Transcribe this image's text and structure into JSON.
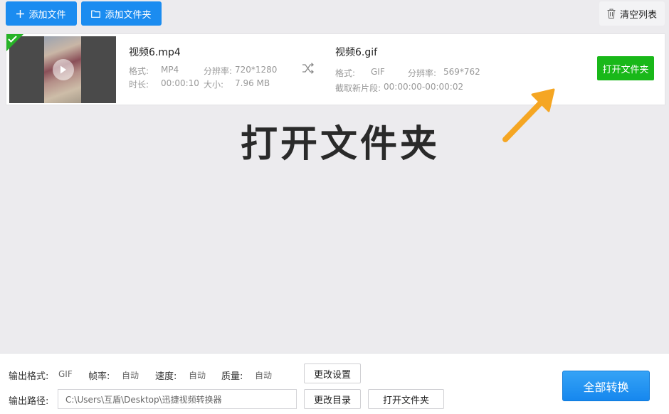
{
  "toolbar": {
    "add_file_label": "添加文件",
    "add_folder_label": "添加文件夹",
    "clear_list_label": "清空列表"
  },
  "file_item": {
    "source": {
      "name": "视频6.mp4",
      "format_label": "格式:",
      "format_value": "MP4",
      "resolution_label": "分辨率:",
      "resolution_value": "720*1280",
      "duration_label": "时长:",
      "duration_value": "00:00:10",
      "size_label": "大小:",
      "size_value": "7.96 MB"
    },
    "output": {
      "name": "视频6.gif",
      "format_label": "格式:",
      "format_value": "GIF",
      "resolution_label": "分辨率:",
      "resolution_value": "569*762",
      "clip_label": "截取新片段:",
      "clip_value": "00:00:00-00:00:02"
    },
    "open_folder_label": "打开文件夹"
  },
  "annotation": {
    "caption": "打开文件夹",
    "arrow_color": "#f5a623"
  },
  "settings": {
    "output_format_label": "输出格式:",
    "output_format_value": "GIF",
    "frame_rate_label": "帧率:",
    "frame_rate_value": "自动",
    "speed_label": "速度:",
    "speed_value": "自动",
    "quality_label": "质量:",
    "quality_value": "自动",
    "change_settings_label": "更改设置",
    "output_path_label": "输出路径:",
    "output_path_value": "C:\\Users\\互盾\\Desktop\\迅捷视频转换器",
    "change_dir_label": "更改目录",
    "open_folder_label": "打开文件夹",
    "convert_all_label": "全部转换"
  },
  "colors": {
    "primary_blue": "#1b8cf0",
    "success_green": "#19b819",
    "check_green": "#27b327"
  },
  "icons": [
    "plus-icon",
    "folder-icon",
    "trash-icon",
    "check-icon",
    "play-icon",
    "shuffle-icon",
    "arrow-icon"
  ]
}
